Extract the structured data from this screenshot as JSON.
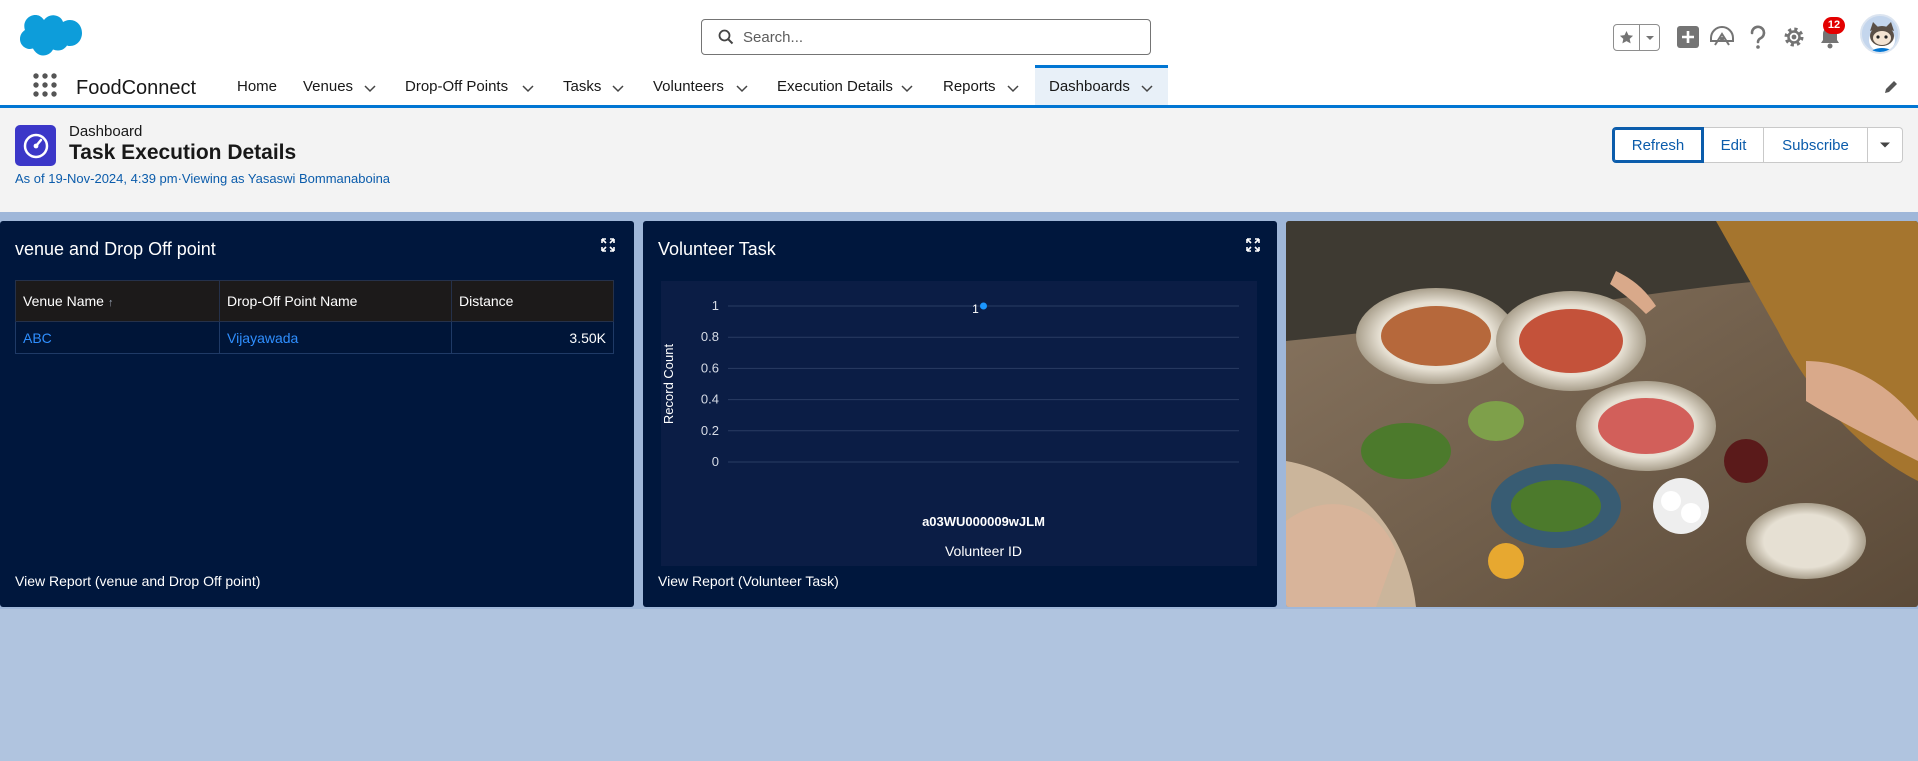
{
  "global_header": {
    "search_placeholder": "Search...",
    "notification_count": "12",
    "icons": [
      "salesforce-cloud-icon",
      "search-icon",
      "star-icon",
      "chevron-down-icon",
      "add-icon",
      "trailhead-icon",
      "help-icon",
      "gear-icon",
      "bell-icon",
      "avatar"
    ]
  },
  "nav": {
    "app_name": "FoodConnect",
    "items": [
      {
        "label": "Home",
        "has_menu": false
      },
      {
        "label": "Venues",
        "has_menu": true
      },
      {
        "label": "Drop-Off Points",
        "has_menu": true
      },
      {
        "label": "Tasks",
        "has_menu": true
      },
      {
        "label": "Volunteers",
        "has_menu": true
      },
      {
        "label": "Execution Details",
        "has_menu": true
      },
      {
        "label": "Reports",
        "has_menu": true
      },
      {
        "label": "Dashboards",
        "has_menu": true,
        "active": true
      }
    ]
  },
  "page_header": {
    "object_label": "Dashboard",
    "title": "Task Execution Details",
    "as_of": "As of 19-Nov-2024, 4:39 pm·Viewing as Yasaswi Bommanaboina",
    "buttons": {
      "refresh": "Refresh",
      "edit": "Edit",
      "subscribe": "Subscribe"
    }
  },
  "widgets": {
    "venue": {
      "title": "venue and Drop Off point",
      "columns": [
        "Venue Name",
        "Drop-Off Point Name",
        "Distance"
      ],
      "sort_indicator": "↑",
      "rows": [
        {
          "venue": "ABC",
          "drop_off": "Vijayawada",
          "distance": "3.50K"
        }
      ],
      "view_report": "View Report (venue and Drop Off point)"
    },
    "volunteer": {
      "title": "Volunteer Task",
      "view_report": "View Report (Volunteer Task)"
    },
    "image": {
      "description": "",
      "colors": {
        "table_wood": "#7c6a54",
        "plate": "#d9d2c4",
        "greens": "#4c7a2c",
        "tomato": "#c7432f"
      }
    }
  },
  "chart_data": {
    "type": "scatter",
    "title": "",
    "xlabel": "Volunteer ID",
    "ylabel": "Record Count",
    "categories": [
      "a03WU000009wJLM"
    ],
    "values": [
      1
    ],
    "data_labels": [
      "1"
    ],
    "yticks": [
      "0",
      "0.2",
      "0.4",
      "0.6",
      "0.8",
      "1"
    ],
    "ylim": [
      0,
      1
    ],
    "grid": true,
    "point_color": "#1b96ff"
  },
  "colors": {
    "brand": "#0176d3",
    "link": "#0b5cab",
    "widget_bg": "#00173d",
    "canvas_bg": "#b0c4df",
    "badge": "#e30000"
  }
}
